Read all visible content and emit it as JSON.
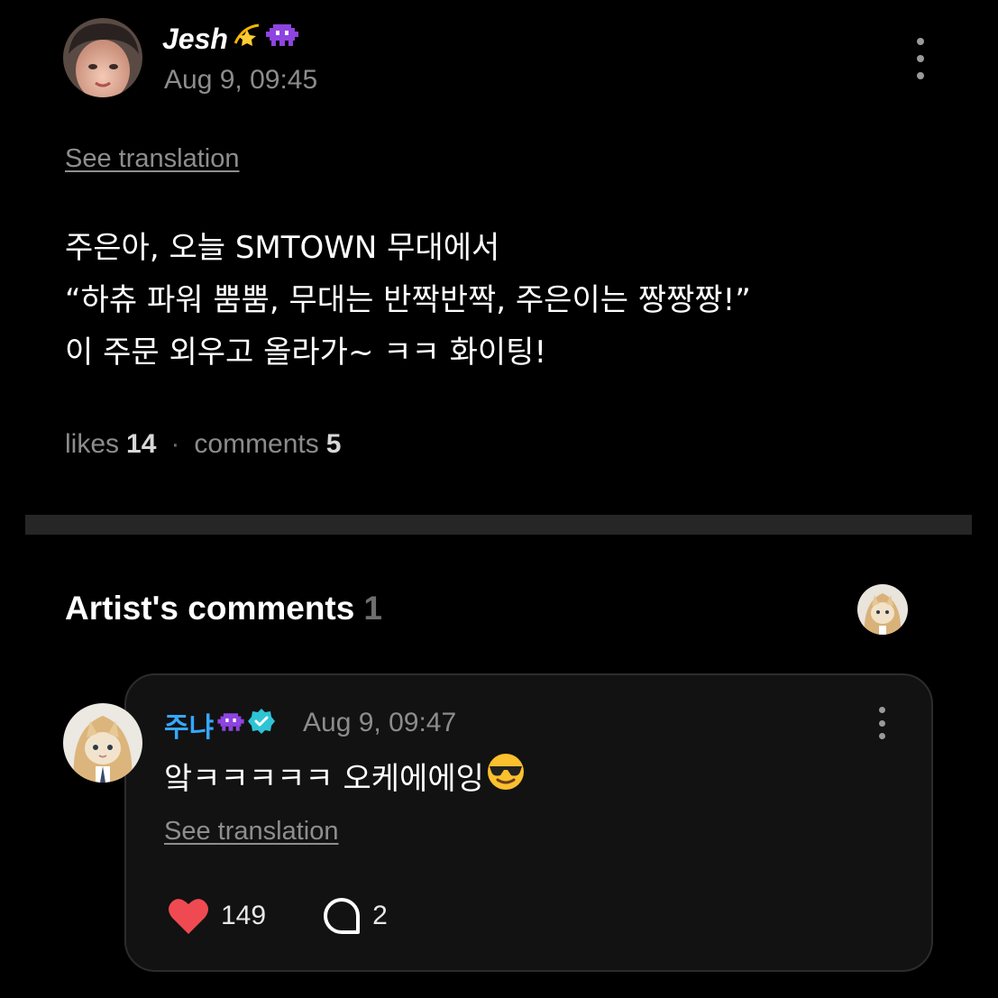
{
  "post": {
    "author": "Jesh",
    "author_emojis": [
      "dizzy-star-emoji",
      "alien-monster-emoji"
    ],
    "time": "Aug 9, 09:45",
    "see_translation": "See translation",
    "body": "주은아, 오늘 SMTOWN 무대에서\n“하츄 파워 뿜뿜, 무대는 반짝반짝, 주은이는 짱짱짱!”\n이 주문 외우고 올라가~ ㅋㅋ 화이팅!",
    "likes_label": "likes",
    "likes_count": "14",
    "comments_label": "comments",
    "comments_count": "5"
  },
  "artist_comments": {
    "title": "Artist's comments",
    "count": "1",
    "comment": {
      "author": "주냐",
      "author_emoji": "alien-monster-emoji",
      "verified_icon": "verified-badge-icon",
      "time": "Aug 9, 09:47",
      "body": "앜ㅋㅋㅋㅋㅋ 오케에에잉",
      "body_emoji": "sunglasses-emoji",
      "see_translation": "See translation",
      "like_count": "149",
      "reply_count": "2"
    }
  },
  "colors": {
    "background": "#000000",
    "accent_blue": "#36a8ff",
    "heart_red": "#ef4a52",
    "card_bg": "#121212",
    "muted_text": "#8c8c8c"
  }
}
